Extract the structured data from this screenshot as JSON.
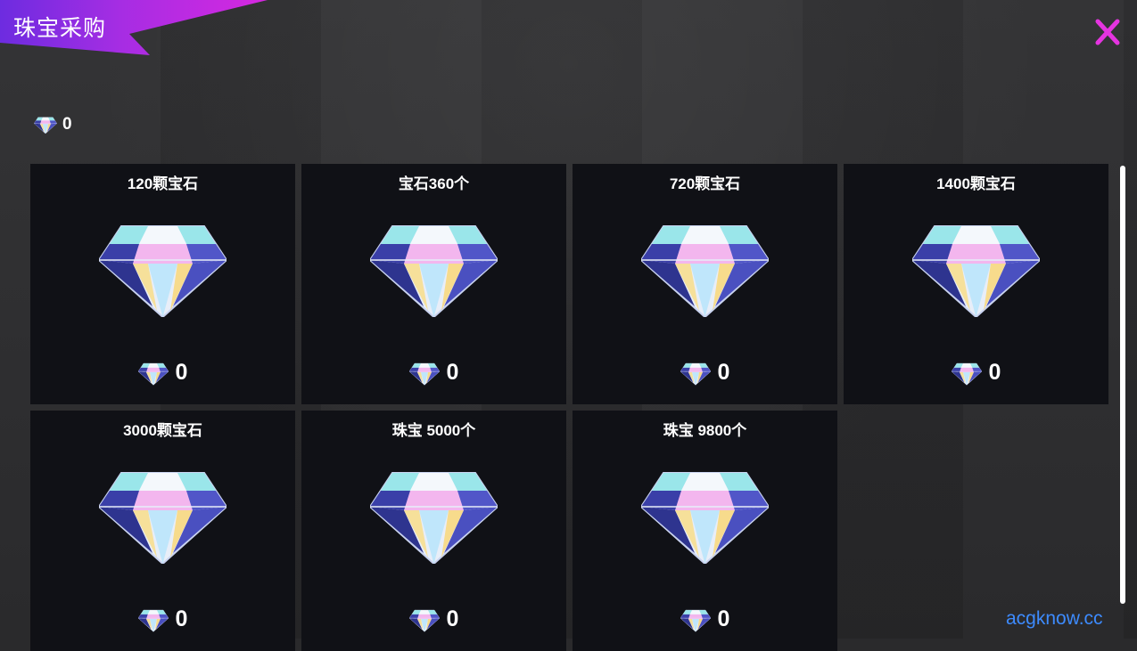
{
  "header": {
    "title": "珠宝采购",
    "close_icon": "close-icon"
  },
  "colors": {
    "ribbon": "#b02de0",
    "close": "#e534e0",
    "card_bg": "#101116",
    "watermark": "#3d8bff"
  },
  "balance": {
    "icon": "diamond-icon",
    "value": "0"
  },
  "packages": [
    {
      "name": "120颗宝石",
      "price": "0"
    },
    {
      "name": "宝石360个",
      "price": "0"
    },
    {
      "name": "720颗宝石",
      "price": "0"
    },
    {
      "name": "1400颗宝石",
      "price": "0"
    },
    {
      "name": "3000颗宝石",
      "price": "0"
    },
    {
      "name": "珠宝 5000个",
      "price": "0"
    },
    {
      "name": "珠宝 9800个",
      "price": "0"
    }
  ],
  "watermark": "acgknow.cc"
}
